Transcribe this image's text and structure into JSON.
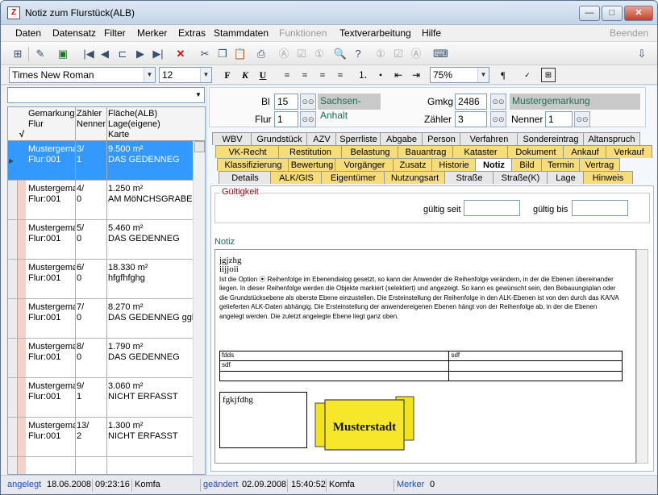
{
  "window": {
    "title": "Notiz zum Flurstück(ALB)",
    "min": "—",
    "max": "□",
    "close": "✕"
  },
  "menu": {
    "items": [
      "Daten",
      "Datensatz",
      "Filter",
      "Merker",
      "Extras",
      "Stammdaten",
      "Funktionen",
      "Textverarbeitung",
      "Hilfe"
    ],
    "right": "Beenden",
    "disabled": [
      "Funktionen",
      "Beenden"
    ]
  },
  "toolbar": {
    "icons": [
      "new-record-icon",
      "edit-icon",
      "save-icon",
      "first-icon",
      "prev-icon",
      "filter-icon",
      "next-icon",
      "last-icon",
      "delete-icon",
      "cut-icon",
      "copy-icon",
      "paste-icon",
      "print-icon",
      "a-box-icon",
      "check-box-icon",
      "one-box-icon",
      "find-icon",
      "help-icon",
      "one-box-icon",
      "check-box-icon",
      "a-box-icon",
      "tool-icon",
      "exit-icon"
    ]
  },
  "format": {
    "font": "Times New Roman",
    "size": "12",
    "bold": "F",
    "italic": "K",
    "underline": "U",
    "zoom": "75%"
  },
  "left": {
    "combo_value": "",
    "headers": {
      "gemarkung": "Gemarkung",
      "flur": "Flur",
      "zaehler": "Zähler",
      "nenner": "Nenner",
      "flaeche": "Fläche(ALB)",
      "lage": "Lage(eigene)",
      "karte": "Karte",
      "check": "√"
    },
    "rows": [
      {
        "gem": "Mustergema",
        "flur": "Flur:001",
        "z": "3/",
        "n": "1",
        "fl": "9.500 m²",
        "lage": "DAS GEDENNEG",
        "sel": true
      },
      {
        "gem": "Mustergema",
        "flur": "Flur:001",
        "z": "4/",
        "n": "0",
        "fl": "1.250 m²",
        "lage": "AM MöNCHSGRABEI",
        "sel": false
      },
      {
        "gem": "Mustergema",
        "flur": "Flur:001",
        "z": "5/",
        "n": "0",
        "fl": "5.460 m²",
        "lage": "DAS GEDENNEG",
        "sel": false
      },
      {
        "gem": "Mustergema",
        "flur": "Flur:001",
        "z": "6/",
        "n": "0",
        "fl": "18.330 m²",
        "lage": "hfgfhfghg",
        "sel": false
      },
      {
        "gem": "Mustergema",
        "flur": "Flur:001",
        "z": "7/",
        "n": "0",
        "fl": "8.270 m²",
        "lage": "DAS GEDENNEG ggl",
        "sel": false
      },
      {
        "gem": "Mustergema",
        "flur": "Flur:001",
        "z": "8/",
        "n": "0",
        "fl": "1.790 m²",
        "lage": "DAS GEDENNEG",
        "sel": false
      },
      {
        "gem": "Mustergema",
        "flur": "Flur:001",
        "z": "9/",
        "n": "1",
        "fl": "3.060 m²",
        "lage": "NICHT ERFASST",
        "sel": false
      },
      {
        "gem": "Mustergema",
        "flur": "Flur:001",
        "z": "13/",
        "n": "2",
        "fl": "1.300 m²",
        "lage": "NICHT ERFASST",
        "sel": false
      }
    ]
  },
  "header": {
    "bl_label": "Bl",
    "bl_value": "15",
    "bl_name": "Sachsen-Anhalt",
    "flur_label": "Flur",
    "flur_value": "1",
    "gmkg_label": "Gmkg",
    "gmkg_value": "2486",
    "gmkg_name": "Mustergemarkung",
    "zaehler_label": "Zähler",
    "zaehler_value": "3",
    "nenner_label": "Nenner",
    "nenner_value": "1"
  },
  "tabs": {
    "row1": [
      "WBV",
      "Grundstück",
      "AZV",
      "Sperrliste",
      "Abgabe",
      "Person",
      "Verfahren",
      "Sondereintrag",
      "Altanspruch"
    ],
    "row2": [
      "VK-Recht",
      "Restitution",
      "Belastung",
      "Bauantrag",
      "Kataster",
      "Dokument",
      "Ankauf",
      "Verkauf"
    ],
    "row3": [
      "Klassifizierung",
      "Bewertung",
      "Vorgänger",
      "Zusatz",
      "Historie",
      "Notiz",
      "Bild",
      "Termin",
      "Vertrag"
    ],
    "row4": [
      "Details",
      "ALK/GIS",
      "Eigentümer",
      "Nutzungsart",
      "Straße",
      "Straße(K)",
      "Lage",
      "Hinweis"
    ],
    "active": "Notiz"
  },
  "notiz": {
    "gueltigkeit": "Gültigkeit",
    "gueltig_seit": "gültig seit",
    "gueltig_bis": "gültig bis",
    "seit_value": "",
    "bis_value": "",
    "label": "Notiz",
    "line1": "jgjzhg",
    "line2": "iijjoii",
    "paragraph": "Ist die Option ⦿ Reihenfolge im Ebenendialog gesetzt, so kann der Anwender die Reihenfolge verändern, in der die Ebenen übereinander liegen. In dieser Reihenfolge werden die Objekte markiert (selektiert) und angezeigt. So kann es gewünscht sein, den Bebauungsplan oder die Grundstücksebene als oberste Ebene einzustellen. Die Ersteinstellung der Reihenfolge in den ALK-Ebenen ist von den durch das KA/VA gelieferten ALK-Daten abhängig. Die Ersteinstellung der anwendereigenen Ebenen hängt von der Reihenfolge ab, in der die Ebenen angelegt werden. Die zuletzt angelegte Ebene liegt ganz oben.",
    "table": [
      [
        "fdds",
        "sdf"
      ],
      [
        "sdf",
        ""
      ],
      [
        "",
        ""
      ]
    ],
    "box_text": "fgkjfdhg",
    "banner_text": "Musterstadt"
  },
  "status": {
    "angelegt_label": "angelegt",
    "angelegt_date": "18.06.2008",
    "angelegt_time": "09:23:16",
    "angelegt_user": "Komfa",
    "geaendert_label": "geändert",
    "geaendert_date": "02.09.2008",
    "geaendert_time": "15:40:52",
    "geaendert_user": "Komfa",
    "merker_label": "Merker",
    "merker_value": "0"
  },
  "colors": {
    "accent": "#3399ff",
    "tab_yellow": "#f7dc7a",
    "green_text": "#1e6d55",
    "status_blue": "#1d4fbf"
  }
}
